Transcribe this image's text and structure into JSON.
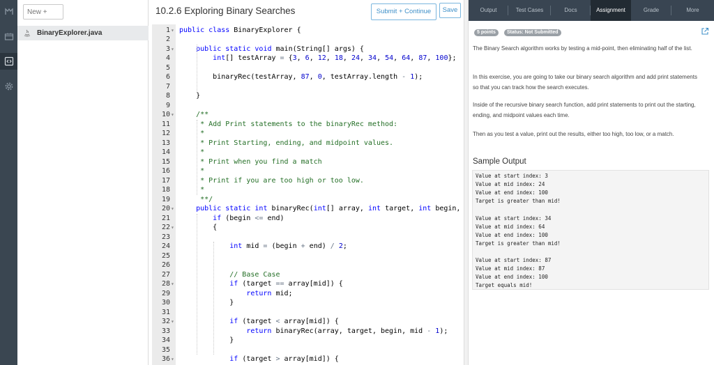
{
  "nav_icons": [
    "logo-icon",
    "files-icon",
    "code-icon",
    "settings-icon"
  ],
  "files": {
    "new_label": "New +",
    "items": [
      {
        "name": "BinaryExplorer.java",
        "icon": "java-file-icon"
      }
    ]
  },
  "header": {
    "title": "10.2.6 Exploring Binary Searches",
    "submit_label": "Submit + Continue",
    "save_label": "Save"
  },
  "editor": {
    "lines": [
      {
        "n": "1",
        "fold": true,
        "code": "public class BinaryExplorer {"
      },
      {
        "n": "2",
        "fold": false,
        "code": ""
      },
      {
        "n": "3",
        "fold": true,
        "code": "    public static void main(String[] args) {"
      },
      {
        "n": "4",
        "fold": false,
        "code": "        int[] testArray = {3, 6, 12, 18, 24, 34, 54, 64, 87, 100};"
      },
      {
        "n": "5",
        "fold": false,
        "code": ""
      },
      {
        "n": "6",
        "fold": false,
        "code": "        binaryRec(testArray, 87, 0, testArray.length - 1);"
      },
      {
        "n": "7",
        "fold": false,
        "code": ""
      },
      {
        "n": "8",
        "fold": false,
        "code": "    }"
      },
      {
        "n": "9",
        "fold": false,
        "code": ""
      },
      {
        "n": "10",
        "fold": true,
        "code": "    /**"
      },
      {
        "n": "11",
        "fold": false,
        "code": "     * Add Print statements to the binaryRec method:"
      },
      {
        "n": "12",
        "fold": false,
        "code": "     *"
      },
      {
        "n": "13",
        "fold": false,
        "code": "     * Print Starting, ending, and midpoint values."
      },
      {
        "n": "14",
        "fold": false,
        "code": "     *"
      },
      {
        "n": "15",
        "fold": false,
        "code": "     * Print when you find a match"
      },
      {
        "n": "16",
        "fold": false,
        "code": "     *"
      },
      {
        "n": "17",
        "fold": false,
        "code": "     * Print if you are too high or too low."
      },
      {
        "n": "18",
        "fold": false,
        "code": "     *"
      },
      {
        "n": "19",
        "fold": false,
        "code": "     **/"
      },
      {
        "n": "20",
        "fold": true,
        "code": "    public static int binaryRec(int[] array, int target, int begin,"
      },
      {
        "n": "21",
        "fold": false,
        "code": "        if (begin <= end)"
      },
      {
        "n": "22",
        "fold": true,
        "code": "        {"
      },
      {
        "n": "23",
        "fold": false,
        "code": ""
      },
      {
        "n": "24",
        "fold": false,
        "code": "            int mid = (begin + end) / 2;"
      },
      {
        "n": "25",
        "fold": false,
        "code": ""
      },
      {
        "n": "26",
        "fold": false,
        "code": ""
      },
      {
        "n": "27",
        "fold": false,
        "code": "            // Base Case"
      },
      {
        "n": "28",
        "fold": true,
        "code": "            if (target == array[mid]) {"
      },
      {
        "n": "29",
        "fold": false,
        "code": "                return mid;"
      },
      {
        "n": "30",
        "fold": false,
        "code": "            }"
      },
      {
        "n": "31",
        "fold": false,
        "code": ""
      },
      {
        "n": "32",
        "fold": true,
        "code": "            if (target < array[mid]) {"
      },
      {
        "n": "33",
        "fold": false,
        "code": "                return binaryRec(array, target, begin, mid - 1);"
      },
      {
        "n": "34",
        "fold": false,
        "code": "            }"
      },
      {
        "n": "35",
        "fold": false,
        "code": ""
      },
      {
        "n": "36",
        "fold": true,
        "code": "            if (target > array[mid]) {"
      }
    ]
  },
  "right_nav": {
    "tabs": [
      "Output",
      "Test Cases",
      "Docs",
      "Assignment",
      "Grade",
      "More"
    ],
    "active": "Assignment"
  },
  "assignment": {
    "points_badge": "5 points",
    "status_badge": "Status: Not Submitted",
    "paragraphs": [
      "The Binary Search algorithm works by testing a mid-point, then eliminating half of the list.",
      "In this exercise, you are going to take our binary search algorithm and add print statements so that you can track how the search executes.",
      "Inside of the recursive binary search function, add print statements to print out the starting, ending, and midpoint values each time.",
      "Then as you test a value, print out the results, either too high, too low, or a match."
    ],
    "sample_title": "Sample Output",
    "sample_output": [
      "Value at start index: 3",
      "Value at mid index: 24",
      "Value at end index: 100",
      "Target is greater than mid!",
      "",
      "Value at start index: 34",
      "Value at mid index: 64",
      "Value at end index: 100",
      "Target is greater than mid!",
      "",
      "Value at start index: 87",
      "Value at mid index: 87",
      "Value at end index: 100",
      "Target equals mid!"
    ]
  },
  "colors": {
    "rail_bg": "#3a4651",
    "nav_bg": "#394552",
    "nav_active": "#222b33",
    "accent": "#3d8fc8",
    "keyword": "#0000ff",
    "comment": "#236e25"
  }
}
